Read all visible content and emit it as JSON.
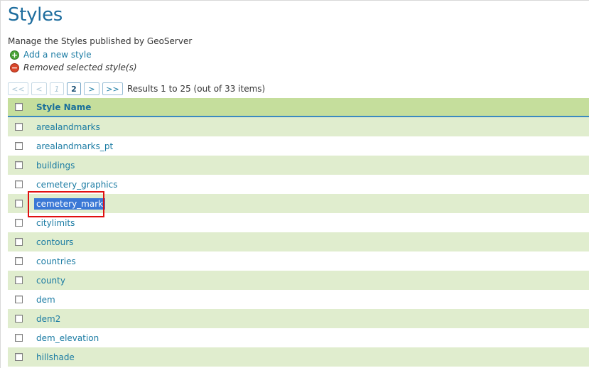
{
  "page": {
    "title": "Styles",
    "description": "Manage the Styles published by GeoServer"
  },
  "actions": {
    "add_label": "Add a new style",
    "remove_label": "Removed selected style(s)"
  },
  "pager": {
    "first": "<<",
    "prev": "<",
    "page1": "1",
    "page2": "2",
    "next": ">",
    "last": ">>",
    "results": "Results 1 to 25 (out of 33 items)"
  },
  "table": {
    "header": "Style Name",
    "rows": [
      "arealandmarks",
      "arealandmarks_pt",
      "buildings",
      "cemetery_graphics",
      "cemetery_mark",
      "citylimits",
      "contours",
      "countries",
      "county",
      "dem",
      "dem2",
      "dem_elevation",
      "hillshade"
    ]
  },
  "colors": {
    "title": "#1e6d9e",
    "link": "#1a7ba3",
    "header_bg": "#c5de9c",
    "row_alt_bg": "#e0edce",
    "selection": "#3a78d6",
    "highlight_box": "#e01010"
  },
  "icons": {
    "add": "plus-circle-icon",
    "remove": "minus-circle-icon"
  }
}
